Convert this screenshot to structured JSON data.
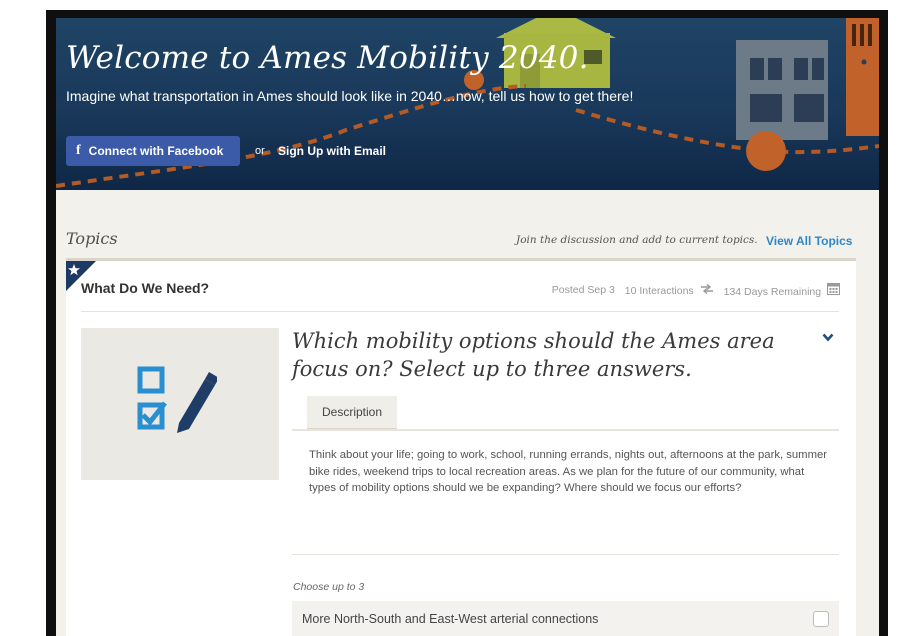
{
  "hero": {
    "title": "Welcome to Ames Mobility 2040.",
    "subtitle": "Imagine what transportation in Ames should look like in 2040…now, tell us how to get there!",
    "facebook_button": "Connect with Facebook",
    "or_text": "or",
    "email_link": "Sign Up with Email"
  },
  "topics": {
    "heading": "Topics",
    "join_text": "Join the discussion and add to current topics.",
    "view_all": "View All Topics"
  },
  "card": {
    "title": "What Do We Need?",
    "posted": "Posted Sep 3",
    "interactions": "10 Interactions",
    "days_remaining": "134 Days Remaining",
    "question": "Which mobility options should the Ames area focus on? Select up to three answers.",
    "tab_label": "Description",
    "description": "Think about your life; going to work, school, running errands, nights out, afternoons at the park, summer bike rides, weekend trips to local recreation areas. As we plan for the future of our community, what types of mobility options should we be expanding? Where should we focus our efforts?",
    "choose_label": "Choose up to 3",
    "options": [
      {
        "label": "More North-South and East-West arterial connections",
        "checked": false
      }
    ]
  },
  "colors": {
    "hero_bg": "#1b3a5c",
    "accent_orange": "#c0622a",
    "link_blue": "#2f87c5",
    "facebook_blue": "#3b5ba9",
    "icon_blue": "#2a8fd0"
  },
  "icons": {
    "facebook": "facebook-f-icon",
    "interactions": "interactions-arrows-icon",
    "calendar": "calendar-icon",
    "chevron": "chevron-down-icon",
    "thumbnail": "checklist-pencil-icon",
    "corner": "star-icon"
  }
}
